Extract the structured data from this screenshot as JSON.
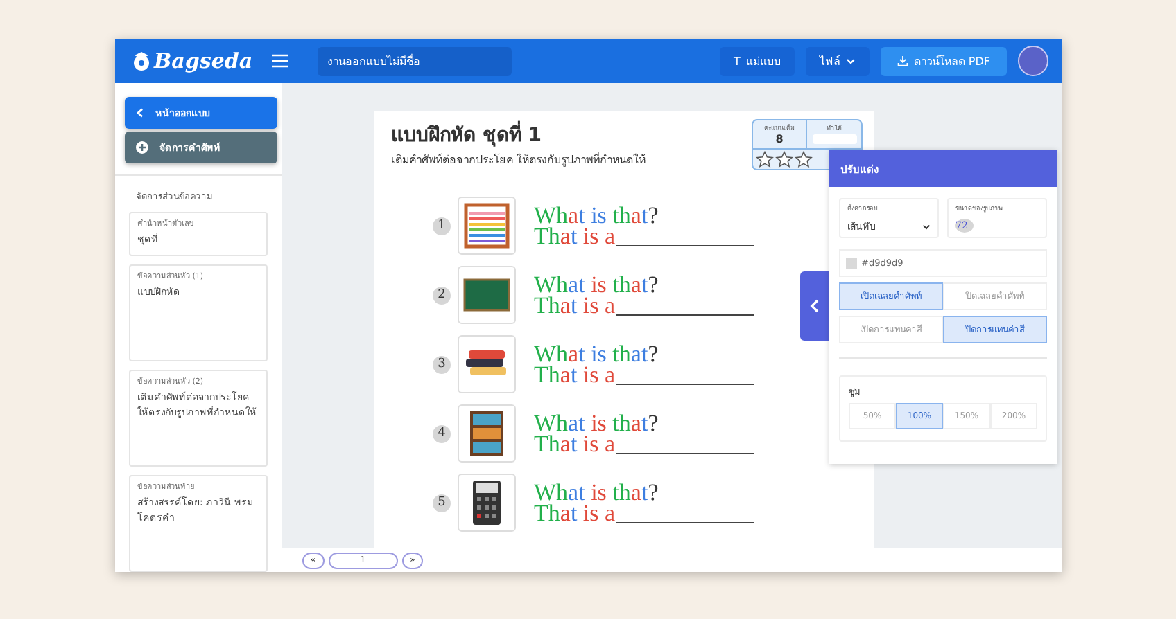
{
  "header": {
    "logo": "Bagseda",
    "document_title": "งานออกแบบไม่มีชื่อ",
    "buttons": [
      {
        "kind": "template",
        "icon": "T",
        "label": "แม่แบบ"
      },
      {
        "kind": "menu",
        "label": "ไฟล์"
      },
      {
        "kind": "download",
        "label": "ดาวน์โหลด PDF"
      }
    ]
  },
  "sidebar": {
    "buttons": [
      {
        "kind": "back",
        "label": "หน้าออกแบบ"
      },
      {
        "kind": "add",
        "label": "จัดการคำศัพท์"
      }
    ],
    "section_title": "จัดการส่วนข้อความ",
    "fields": [
      {
        "label": "คำนำหน้าตัวเลข",
        "value": "ชุดที่",
        "kind": "single"
      },
      {
        "label": "ข้อความส่วนหัว (1)",
        "value": "แบบฝึกหัด",
        "kind": "multi"
      },
      {
        "label": "ข้อความส่วนหัว (2)",
        "value": "เติมคำศัพท์ต่อจากประโยค ให้ตรงกับรูปภาพที่กำหนดให้",
        "kind": "multi"
      },
      {
        "label": "ข้อความส่วนท้าย",
        "value": "สร้างสรรค์โดย: ภาวินี พรมโคตรคำ",
        "kind": "multi"
      }
    ]
  },
  "worksheet": {
    "title": "แบบฝึกหัด ชุดที่ 1",
    "subtitle": "เติมคำศัพท์ต่อจากประโยค ให้ตรงกับรูปภาพที่กำหนดให้",
    "score": {
      "full_label": "คะแนนเต็ม",
      "full_value": "8",
      "got_label": "ทำได้",
      "stars": 0
    },
    "items": [
      {
        "number": "1",
        "question": [
          {
            "text": "Wh",
            "color": "#22b04b"
          },
          {
            "text": "a",
            "color": "#e0493a"
          },
          {
            "text": "t ",
            "color": "#3d7ee0"
          },
          {
            "text": "is ",
            "color": "#3d7ee0"
          },
          {
            "text": "th",
            "color": "#22b04b"
          },
          {
            "text": "a",
            "color": "#e0493a"
          },
          {
            "text": "t",
            "color": "#3d7ee0"
          },
          {
            "text": "?",
            "color": "#333333"
          }
        ],
        "answer": [
          {
            "text": "Th",
            "color": "#22b04b"
          },
          {
            "text": "a",
            "color": "#e0493a"
          },
          {
            "text": "t ",
            "color": "#3d7ee0"
          },
          {
            "text": "is a",
            "color": "#e0493a"
          }
        ]
      },
      {
        "number": "2",
        "question": [
          {
            "text": "Wh",
            "color": "#22b04b"
          },
          {
            "text": "a",
            "color": "#3d7ee0"
          },
          {
            "text": "t ",
            "color": "#3d7ee0"
          },
          {
            "text": "is ",
            "color": "#e0493a"
          },
          {
            "text": "th",
            "color": "#22b04b"
          },
          {
            "text": "a",
            "color": "#e0493a"
          },
          {
            "text": "t",
            "color": "#3d7ee0"
          },
          {
            "text": "?",
            "color": "#333333"
          }
        ],
        "answer": [
          {
            "text": "Th",
            "color": "#22b04b"
          },
          {
            "text": "a",
            "color": "#e0493a"
          },
          {
            "text": "t ",
            "color": "#3d7ee0"
          },
          {
            "text": "is a",
            "color": "#e0493a"
          }
        ]
      },
      {
        "number": "3",
        "question": [
          {
            "text": "Wh",
            "color": "#22b04b"
          },
          {
            "text": "a",
            "color": "#e0493a"
          },
          {
            "text": "t ",
            "color": "#3d7ee0"
          },
          {
            "text": "is ",
            "color": "#3d7ee0"
          },
          {
            "text": "th",
            "color": "#22b04b"
          },
          {
            "text": "a",
            "color": "#3d7ee0"
          },
          {
            "text": "t",
            "color": "#3d7ee0"
          },
          {
            "text": "?",
            "color": "#333333"
          }
        ],
        "answer": [
          {
            "text": "Th",
            "color": "#22b04b"
          },
          {
            "text": "a",
            "color": "#e0493a"
          },
          {
            "text": "t ",
            "color": "#3d7ee0"
          },
          {
            "text": "is a",
            "color": "#e0493a"
          }
        ]
      },
      {
        "number": "4",
        "question": [
          {
            "text": "Wh",
            "color": "#22b04b"
          },
          {
            "text": "a",
            "color": "#3d7ee0"
          },
          {
            "text": "t ",
            "color": "#3d7ee0"
          },
          {
            "text": "is ",
            "color": "#e0493a"
          },
          {
            "text": "th",
            "color": "#22b04b"
          },
          {
            "text": "a",
            "color": "#e0493a"
          },
          {
            "text": "t",
            "color": "#3d7ee0"
          },
          {
            "text": "?",
            "color": "#333333"
          }
        ],
        "answer": [
          {
            "text": "Th",
            "color": "#22b04b"
          },
          {
            "text": "a",
            "color": "#e0493a"
          },
          {
            "text": "t ",
            "color": "#3d7ee0"
          },
          {
            "text": "is a",
            "color": "#e0493a"
          }
        ]
      },
      {
        "number": "5",
        "question": [
          {
            "text": "Wh",
            "color": "#22b04b"
          },
          {
            "text": "a",
            "color": "#3d7ee0"
          },
          {
            "text": "t ",
            "color": "#3d7ee0"
          },
          {
            "text": "is ",
            "color": "#e0493a"
          },
          {
            "text": "th",
            "color": "#22b04b"
          },
          {
            "text": "a",
            "color": "#e0493a"
          },
          {
            "text": "t",
            "color": "#3d7ee0"
          },
          {
            "text": "?",
            "color": "#333333"
          }
        ],
        "answer": [
          {
            "text": "Th",
            "color": "#22b04b"
          },
          {
            "text": "a",
            "color": "#e0493a"
          },
          {
            "text": "t ",
            "color": "#3d7ee0"
          },
          {
            "text": "is a",
            "color": "#e0493a"
          }
        ]
      }
    ]
  },
  "pagination": {
    "prev": "«",
    "page": "1",
    "next": "»"
  },
  "settings": {
    "title": "ปรับแต่ง",
    "frame_label": "ตั้งค่ากรอบ",
    "frame_value": "เส้นทึบ",
    "size_label": "ขนาดของรูปภาพ",
    "size_value": "72",
    "color": "#d9d9d9",
    "toggles": [
      [
        {
          "label": "เปิดเฉลยคำศัพท์",
          "selected": true
        },
        {
          "label": "ปิดเฉลยคำศัพท์",
          "selected": false
        }
      ],
      [
        {
          "label": "เปิดการแทนค่าสี",
          "selected": false
        },
        {
          "label": "ปิดการแทนค่าสี",
          "selected": true
        }
      ]
    ],
    "zoom_label": "ซูม",
    "zoom": [
      {
        "label": "50%",
        "selected": false
      },
      {
        "label": "100%",
        "selected": true
      },
      {
        "label": "150%",
        "selected": false
      },
      {
        "label": "200%",
        "selected": false
      }
    ]
  }
}
